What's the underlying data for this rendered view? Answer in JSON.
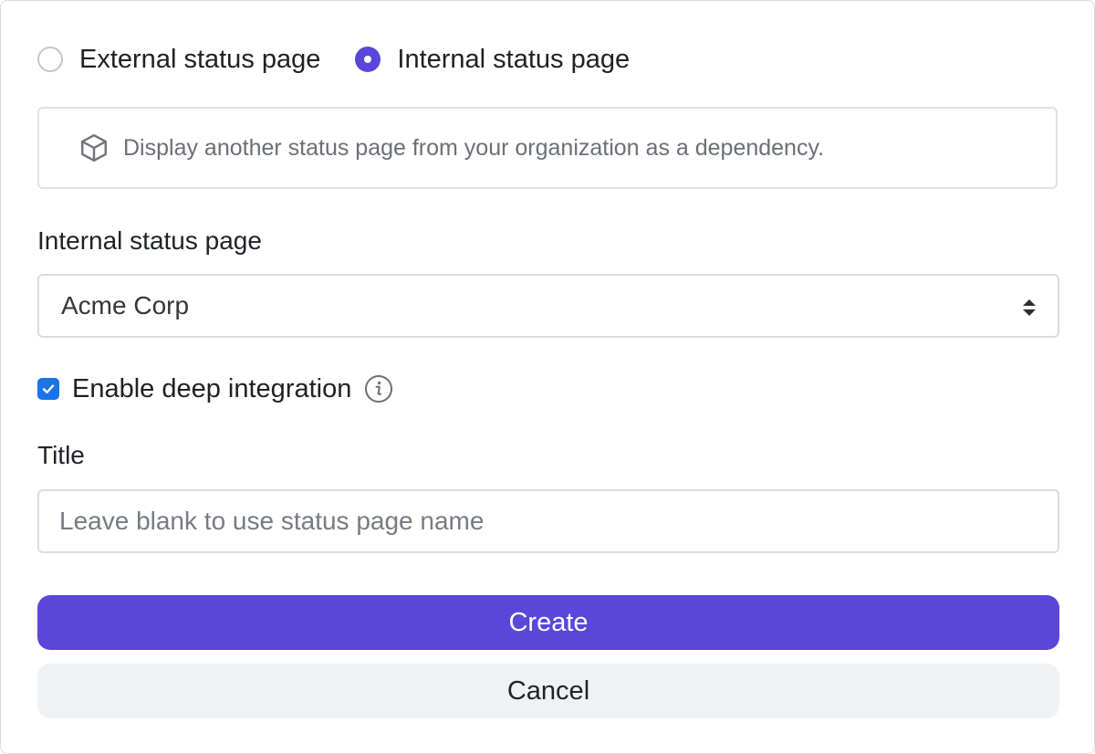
{
  "source_type": {
    "options": [
      {
        "label": "External status page",
        "checked": false
      },
      {
        "label": "Internal status page",
        "checked": true
      }
    ]
  },
  "info": {
    "icon": "cube-icon",
    "text": "Display another status page from your organization as a dependency."
  },
  "internal_page": {
    "label": "Internal status page",
    "selected": "Acme Corp"
  },
  "deep_integration": {
    "label": "Enable deep integration",
    "checked": true,
    "icon": "info-icon"
  },
  "title_field": {
    "label": "Title",
    "value": "",
    "placeholder": "Leave blank to use status page name"
  },
  "actions": {
    "create_label": "Create",
    "cancel_label": "Cancel"
  },
  "colors": {
    "primary": "#5a46d8",
    "checkbox": "#1a73e8",
    "secondary_bg": "#f0f1f3",
    "border": "#d9dbe0"
  }
}
